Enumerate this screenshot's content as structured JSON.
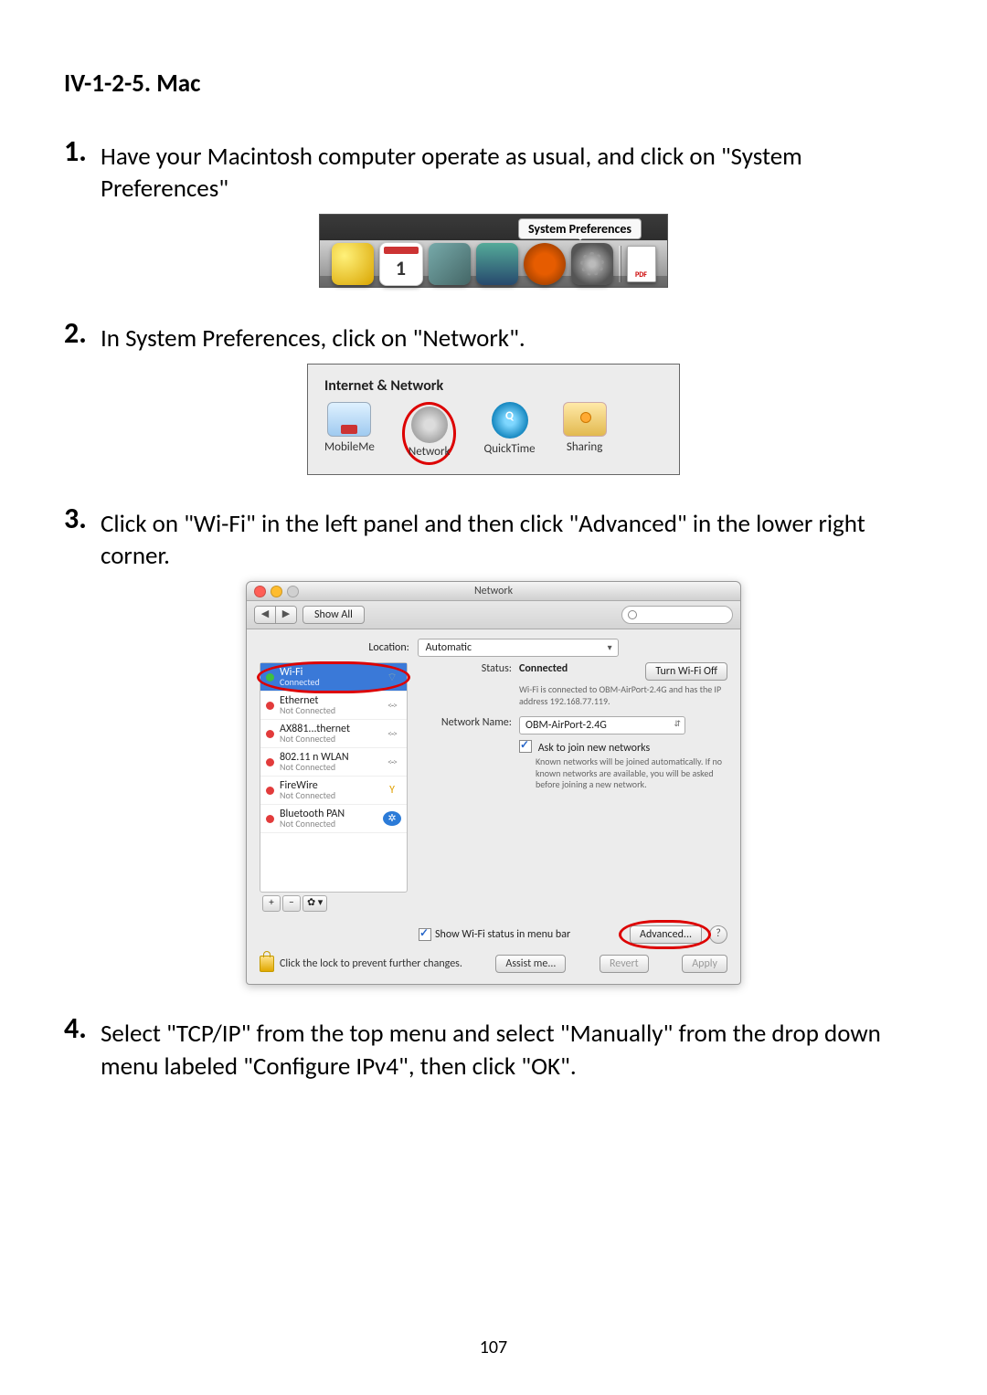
{
  "heading": "IV-1-2-5.    Mac",
  "page_number": "107",
  "steps": {
    "s1": {
      "num": "1.",
      "text": "Have your Macintosh computer operate as usual, and click on \"System Preferences\""
    },
    "s2": {
      "num": "2.",
      "text": "In System Preferences, click on \"Network\"."
    },
    "s3": {
      "num": "3.",
      "text": "Click on \"Wi-Fi\" in the left panel and then click \"Advanced\" in the lower right corner."
    },
    "s4": {
      "num": "4.",
      "text": "Select \"TCP/IP\" from the top menu and select \"Manually\" from the drop down menu labeled \"Configure IPv4\", then click \"OK\"."
    }
  },
  "dock": {
    "tooltip": "System Preferences"
  },
  "inet": {
    "title": "Internet & Network",
    "mobileme": "MobileMe",
    "network": "Network",
    "quicktime": "QuickTime",
    "sharing": "Sharing"
  },
  "netwin": {
    "title": "Network",
    "showall": "Show All",
    "loc_label": "Location:",
    "loc_value": "Automatic",
    "services": {
      "wifi": {
        "name": "Wi-Fi",
        "sub": "Connected"
      },
      "ethernet": {
        "name": "Ethernet",
        "sub": "Not Connected"
      },
      "ax": {
        "name": "AX881...thernet",
        "sub": "Not Connected"
      },
      "wlan": {
        "name": "802.11 n WLAN",
        "sub": "Not Connected"
      },
      "firewire": {
        "name": "FireWire",
        "sub": "Not Connected"
      },
      "btpan": {
        "name": "Bluetooth PAN",
        "sub": "Not Connected"
      }
    },
    "footer_add": "+",
    "footer_rem": "−",
    "footer_cog": "✿ ▾",
    "status_label": "Status:",
    "status_value": "Connected",
    "turn_off": "Turn Wi-Fi Off",
    "status_desc": "Wi-Fi is connected to OBM-AirPort-2.4G and has the IP address 192.168.77.119.",
    "netname_label": "Network Name:",
    "netname_value": "OBM-AirPort-2.4G",
    "ask_label": "Ask to join new networks",
    "ask_desc": "Known networks will be joined automatically. If no known networks are available, you will be asked before joining a new network.",
    "menubar": "Show Wi-Fi status in menu bar",
    "advanced": "Advanced...",
    "help": "?",
    "lock_text": "Click the lock to prevent further changes.",
    "assist": "Assist me...",
    "revert": "Revert",
    "apply": "Apply"
  }
}
